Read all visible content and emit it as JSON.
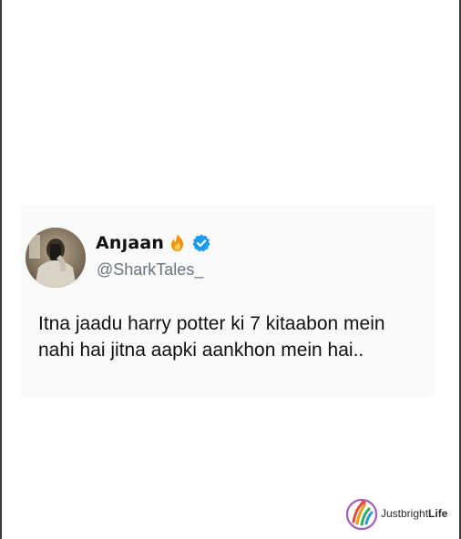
{
  "tweet": {
    "display_name": "Anȷaan",
    "name_emoji_icon": "fire-icon",
    "verified_icon": "verified-badge-icon",
    "handle": "@SharkTales_",
    "text": "Itna jaadu harry potter ki 7 kitaabon mein nahi hai jitna aapki aankhon mein hai..",
    "verified_color": "#1d9bf0",
    "avatar_icon": "profile-photo"
  },
  "watermark": {
    "brand_light": "Justbright",
    "brand_bold": "Life",
    "logo_icon": "justbrightlife-logo-icon"
  }
}
